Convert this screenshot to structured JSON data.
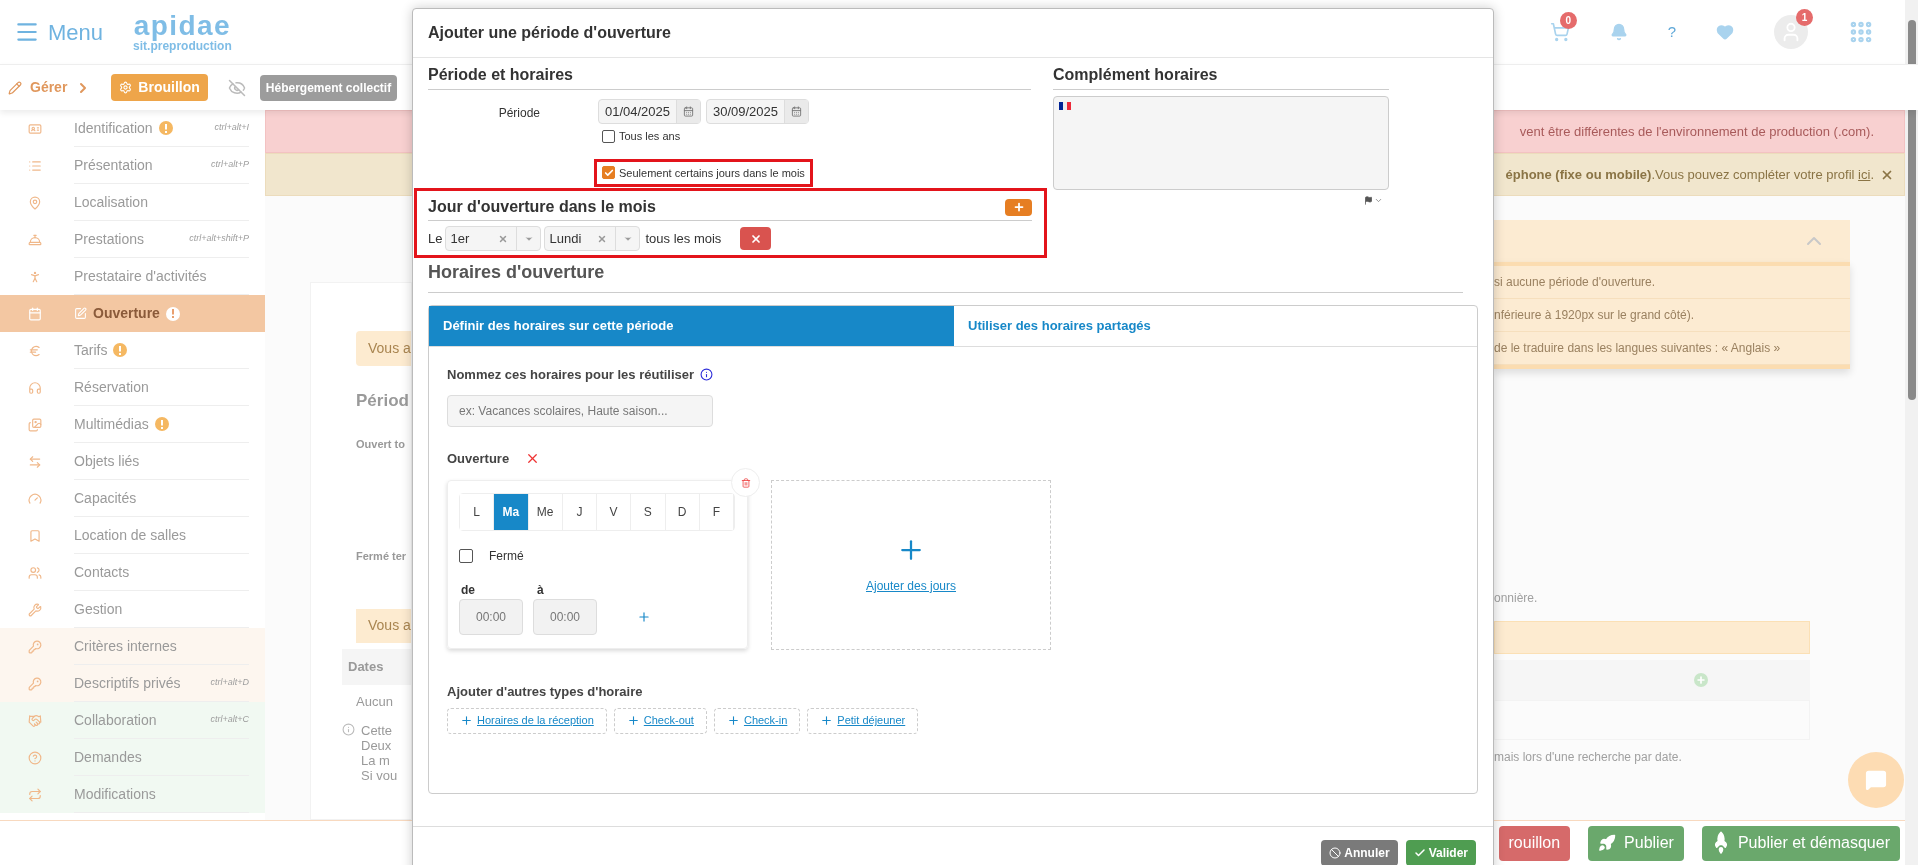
{
  "header": {
    "menu_label": "Menu",
    "logo": "apidae",
    "logo_subtitle": "sit.preproduction",
    "cart_count": "0",
    "help": "?",
    "profile_count": "1"
  },
  "toolbar": {
    "breadcrumb": "Gérer",
    "status": "Brouillon",
    "type_tag": "Hébergement collectif"
  },
  "sidebar": {
    "items": [
      {
        "label": "Identification",
        "shortcut": "ctrl+alt+I",
        "warning": true,
        "selected": false,
        "kind": "main"
      },
      {
        "label": "Présentation",
        "shortcut": "ctrl+alt+P",
        "warning": false,
        "selected": false,
        "kind": "main"
      },
      {
        "label": "Localisation",
        "warning": false,
        "selected": false,
        "kind": "main"
      },
      {
        "label": "Prestations",
        "shortcut": "ctrl+alt+shift+P",
        "warning": false,
        "selected": false,
        "kind": "main"
      },
      {
        "label": "Prestataire d'activités",
        "warning": false,
        "selected": false,
        "kind": "main"
      },
      {
        "label": "Ouverture",
        "warning": true,
        "selected": true,
        "kind": "main"
      },
      {
        "label": "Tarifs",
        "warning": true,
        "selected": false,
        "kind": "main"
      },
      {
        "label": "Réservation",
        "warning": false,
        "selected": false,
        "kind": "main"
      },
      {
        "label": "Multimédias",
        "warning": true,
        "selected": false,
        "kind": "main"
      },
      {
        "label": "Objets liés",
        "warning": false,
        "selected": false,
        "kind": "main"
      },
      {
        "label": "Capacités",
        "warning": false,
        "selected": false,
        "kind": "main"
      },
      {
        "label": "Location de salles",
        "warning": false,
        "selected": false,
        "kind": "main"
      },
      {
        "label": "Contacts",
        "warning": false,
        "selected": false,
        "kind": "main"
      },
      {
        "label": "Gestion",
        "warning": false,
        "selected": false,
        "kind": "main"
      },
      {
        "label": "Critères internes",
        "warning": false,
        "selected": false,
        "kind": "internal"
      },
      {
        "label": "Descriptifs privés",
        "shortcut": "ctrl+alt+D",
        "warning": false,
        "selected": false,
        "kind": "internal"
      },
      {
        "label": "Collaboration",
        "shortcut": "ctrl+alt+C",
        "warning": false,
        "selected": false,
        "kind": "collab"
      },
      {
        "label": "Demandes",
        "warning": false,
        "selected": false,
        "kind": "collab"
      },
      {
        "label": "Modifications",
        "warning": false,
        "selected": false,
        "kind": "collab"
      }
    ]
  },
  "banners": [
    {
      "kind": "danger",
      "text": "vent être différentes de l'environnement de production (.com)."
    },
    {
      "kind": "warning",
      "text": "**éphone (fixe ou mobile)**.Vous pouvez compléter votre profil ",
      "link": "ici",
      "after": ".",
      "closable": true
    }
  ],
  "background_left": {
    "notice_1": "Vous a",
    "heading": "Périod",
    "open_label": "Ouvert to",
    "closed_label": "Fermé ter",
    "notice_2": "Vous a",
    "table_header": "Dates",
    "table_empty": "Aucun",
    "info_lines": [
      "Cette",
      "Deux",
      "La m",
      "Si vou"
    ]
  },
  "background_right": {
    "tips": [
      "si aucune période d'ouverture.",
      "nférieure à 1920px sur le grand côté).",
      "de le traduire dans les langues suivantes : « Anglais »"
    ],
    "text_1": "onnière.",
    "text_2": "mais lors d'une recherche par date."
  },
  "footer_buttons": [
    {
      "label": "rouillon",
      "kind": "danger"
    },
    {
      "label": "Publier",
      "kind": "publish"
    },
    {
      "label": "Publier et démasquer",
      "kind": "publish_unmask"
    }
  ],
  "modal": {
    "title": "Ajouter une période d'ouverture",
    "period": {
      "heading": "Période et horaires",
      "label": "Période",
      "start": "01/04/2025",
      "end": "30/09/2025",
      "every_year": {
        "label": "Tous les ans",
        "checked": false
      },
      "some_days": {
        "label": "Seulement certains jours dans le mois",
        "checked": true,
        "highlighted": true
      }
    },
    "complement": {
      "heading": "Complément horaires"
    },
    "monthly": {
      "heading": "Jour d'ouverture dans le mois",
      "highlighted": true,
      "rules": [
        {
          "prefix": "Le",
          "ordinal": "1er",
          "weekday": "Lundi",
          "suffix": "tous les mois"
        }
      ]
    },
    "hours": {
      "heading": "Horaires d'ouverture",
      "tabs": [
        {
          "label": "Définir des horaires sur cette période",
          "selected": true
        },
        {
          "label": "Utiliser des horaires partagés",
          "selected": false
        }
      ],
      "name_label": "Nommez ces horaires pour les réutiliser",
      "name_placeholder": "ex: Vacances scolaires, Haute saison...",
      "opening_label": "Ouverture",
      "days": [
        {
          "label": "L",
          "selected": false
        },
        {
          "label": "Ma",
          "selected": true
        },
        {
          "label": "Me",
          "selected": false
        },
        {
          "label": "J",
          "selected": false
        },
        {
          "label": "V",
          "selected": false
        },
        {
          "label": "S",
          "selected": false
        },
        {
          "label": "D",
          "selected": false
        },
        {
          "label": "F",
          "selected": false
        }
      ],
      "closed": {
        "label": "Fermé",
        "checked": false
      },
      "from_label": "de",
      "to_label": "à",
      "from_placeholder": "00:00",
      "to_placeholder": "00:00",
      "add_days": "Ajouter des jours",
      "other_label": "Ajouter d'autres types d'horaire",
      "other_types": [
        "Horaires de la réception",
        "Check-out",
        "Check-in",
        "Petit déjeuner"
      ]
    },
    "buttons": [
      {
        "label": "Annuler",
        "kind": "cancel"
      },
      {
        "label": "Valider",
        "kind": "confirm"
      }
    ]
  }
}
